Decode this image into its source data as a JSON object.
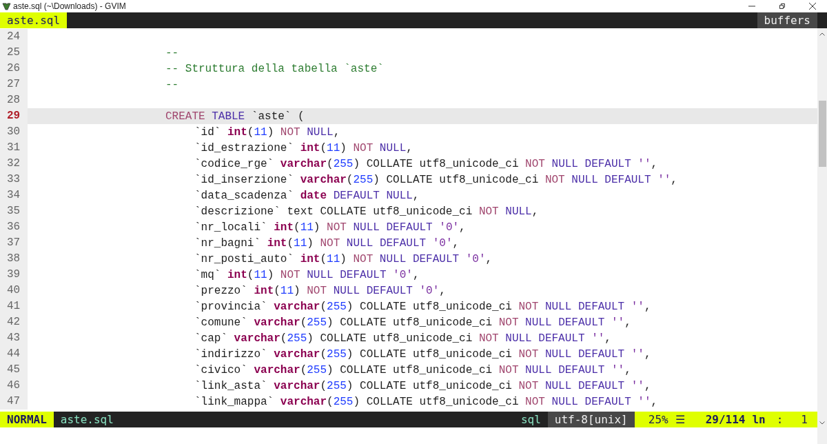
{
  "window": {
    "title": "aste.sql (~\\Downloads) - GVIM"
  },
  "tabline": {
    "tabs": [
      {
        "label": "aste.sql",
        "selected": true
      }
    ],
    "right_label": "buffers"
  },
  "lines": [
    {
      "number": "24",
      "kind": "blank",
      "current": false
    },
    {
      "number": "25",
      "kind": "comment",
      "current": false,
      "tokens": [
        {
          "kind": "comment",
          "text": "--"
        }
      ]
    },
    {
      "number": "26",
      "kind": "comment",
      "current": false,
      "tokens": [
        {
          "kind": "comment",
          "text": "-- Struttura della tabella `aste`"
        }
      ]
    },
    {
      "number": "27",
      "kind": "comment",
      "current": false,
      "tokens": [
        {
          "kind": "comment",
          "text": "--"
        }
      ]
    },
    {
      "number": "28",
      "kind": "blank",
      "current": false
    },
    {
      "number": "29",
      "kind": "statement",
      "current": true,
      "tokens": [
        {
          "kind": "keyword",
          "text": "CREATE"
        },
        {
          "kind": "constant",
          "text": " TABLE"
        },
        {
          "kind": "plain",
          "text": " `aste` ("
        }
      ]
    },
    {
      "number": "30",
      "kind": "column",
      "current": false,
      "tokens": [
        {
          "kind": "plain",
          "text": "`id` "
        },
        {
          "kind": "type",
          "text": "int"
        },
        {
          "kind": "plain",
          "text": "("
        },
        {
          "kind": "number",
          "text": "11"
        },
        {
          "kind": "plain",
          "text": ") "
        },
        {
          "kind": "keyword",
          "text": "NOT"
        },
        {
          "kind": "constant",
          "text": " NULL"
        },
        {
          "kind": "plain",
          "text": ","
        }
      ]
    },
    {
      "number": "31",
      "kind": "column",
      "current": false,
      "tokens": [
        {
          "kind": "plain",
          "text": "`id_estrazione` "
        },
        {
          "kind": "type",
          "text": "int"
        },
        {
          "kind": "plain",
          "text": "("
        },
        {
          "kind": "number",
          "text": "11"
        },
        {
          "kind": "plain",
          "text": ") "
        },
        {
          "kind": "keyword",
          "text": "NOT"
        },
        {
          "kind": "constant",
          "text": " NULL"
        },
        {
          "kind": "plain",
          "text": ","
        }
      ]
    },
    {
      "number": "32",
      "kind": "column",
      "current": false,
      "tokens": [
        {
          "kind": "plain",
          "text": "`codice_rge` "
        },
        {
          "kind": "type",
          "text": "varchar"
        },
        {
          "kind": "plain",
          "text": "("
        },
        {
          "kind": "number",
          "text": "255"
        },
        {
          "kind": "plain",
          "text": ") COLLATE utf8_unicode_ci "
        },
        {
          "kind": "keyword",
          "text": "NOT"
        },
        {
          "kind": "constant",
          "text": " NULL DEFAULT "
        },
        {
          "kind": "string",
          "text": "''"
        },
        {
          "kind": "plain",
          "text": ","
        }
      ]
    },
    {
      "number": "33",
      "kind": "column",
      "current": false,
      "tokens": [
        {
          "kind": "plain",
          "text": "`id_inserzione` "
        },
        {
          "kind": "type",
          "text": "varchar"
        },
        {
          "kind": "plain",
          "text": "("
        },
        {
          "kind": "number",
          "text": "255"
        },
        {
          "kind": "plain",
          "text": ") COLLATE utf8_unicode_ci "
        },
        {
          "kind": "keyword",
          "text": "NOT"
        },
        {
          "kind": "constant",
          "text": " NULL DEFAULT "
        },
        {
          "kind": "string",
          "text": "''"
        },
        {
          "kind": "plain",
          "text": ","
        }
      ]
    },
    {
      "number": "34",
      "kind": "column",
      "current": false,
      "tokens": [
        {
          "kind": "plain",
          "text": "`data_scadenza` "
        },
        {
          "kind": "type",
          "text": "date"
        },
        {
          "kind": "constant",
          "text": " DEFAULT NULL"
        },
        {
          "kind": "plain",
          "text": ","
        }
      ]
    },
    {
      "number": "35",
      "kind": "column",
      "current": false,
      "tokens": [
        {
          "kind": "plain",
          "text": "`descrizione` text COLLATE utf8_unicode_ci "
        },
        {
          "kind": "keyword",
          "text": "NOT"
        },
        {
          "kind": "constant",
          "text": " NULL"
        },
        {
          "kind": "plain",
          "text": ","
        }
      ]
    },
    {
      "number": "36",
      "kind": "column",
      "current": false,
      "tokens": [
        {
          "kind": "plain",
          "text": "`nr_locali` "
        },
        {
          "kind": "type",
          "text": "int"
        },
        {
          "kind": "plain",
          "text": "("
        },
        {
          "kind": "number",
          "text": "11"
        },
        {
          "kind": "plain",
          "text": ") "
        },
        {
          "kind": "keyword",
          "text": "NOT"
        },
        {
          "kind": "constant",
          "text": " NULL DEFAULT "
        },
        {
          "kind": "string",
          "text": "'0'"
        },
        {
          "kind": "plain",
          "text": ","
        }
      ]
    },
    {
      "number": "37",
      "kind": "column",
      "current": false,
      "tokens": [
        {
          "kind": "plain",
          "text": "`nr_bagni` "
        },
        {
          "kind": "type",
          "text": "int"
        },
        {
          "kind": "plain",
          "text": "("
        },
        {
          "kind": "number",
          "text": "11"
        },
        {
          "kind": "plain",
          "text": ") "
        },
        {
          "kind": "keyword",
          "text": "NOT"
        },
        {
          "kind": "constant",
          "text": " NULL DEFAULT "
        },
        {
          "kind": "string",
          "text": "'0'"
        },
        {
          "kind": "plain",
          "text": ","
        }
      ]
    },
    {
      "number": "38",
      "kind": "column",
      "current": false,
      "tokens": [
        {
          "kind": "plain",
          "text": "`nr_posti_auto` "
        },
        {
          "kind": "type",
          "text": "int"
        },
        {
          "kind": "plain",
          "text": "("
        },
        {
          "kind": "number",
          "text": "11"
        },
        {
          "kind": "plain",
          "text": ") "
        },
        {
          "kind": "keyword",
          "text": "NOT"
        },
        {
          "kind": "constant",
          "text": " NULL DEFAULT "
        },
        {
          "kind": "string",
          "text": "'0'"
        },
        {
          "kind": "plain",
          "text": ","
        }
      ]
    },
    {
      "number": "39",
      "kind": "column",
      "current": false,
      "tokens": [
        {
          "kind": "plain",
          "text": "`mq` "
        },
        {
          "kind": "type",
          "text": "int"
        },
        {
          "kind": "plain",
          "text": "("
        },
        {
          "kind": "number",
          "text": "11"
        },
        {
          "kind": "plain",
          "text": ") "
        },
        {
          "kind": "keyword",
          "text": "NOT"
        },
        {
          "kind": "constant",
          "text": " NULL DEFAULT "
        },
        {
          "kind": "string",
          "text": "'0'"
        },
        {
          "kind": "plain",
          "text": ","
        }
      ]
    },
    {
      "number": "40",
      "kind": "column",
      "current": false,
      "tokens": [
        {
          "kind": "plain",
          "text": "`prezzo` "
        },
        {
          "kind": "type",
          "text": "int"
        },
        {
          "kind": "plain",
          "text": "("
        },
        {
          "kind": "number",
          "text": "11"
        },
        {
          "kind": "plain",
          "text": ") "
        },
        {
          "kind": "keyword",
          "text": "NOT"
        },
        {
          "kind": "constant",
          "text": " NULL DEFAULT "
        },
        {
          "kind": "string",
          "text": "'0'"
        },
        {
          "kind": "plain",
          "text": ","
        }
      ]
    },
    {
      "number": "41",
      "kind": "column",
      "current": false,
      "tokens": [
        {
          "kind": "plain",
          "text": "`provincia` "
        },
        {
          "kind": "type",
          "text": "varchar"
        },
        {
          "kind": "plain",
          "text": "("
        },
        {
          "kind": "number",
          "text": "255"
        },
        {
          "kind": "plain",
          "text": ") COLLATE utf8_unicode_ci "
        },
        {
          "kind": "keyword",
          "text": "NOT"
        },
        {
          "kind": "constant",
          "text": " NULL DEFAULT "
        },
        {
          "kind": "string",
          "text": "''"
        },
        {
          "kind": "plain",
          "text": ","
        }
      ]
    },
    {
      "number": "42",
      "kind": "column",
      "current": false,
      "tokens": [
        {
          "kind": "plain",
          "text": "`comune` "
        },
        {
          "kind": "type",
          "text": "varchar"
        },
        {
          "kind": "plain",
          "text": "("
        },
        {
          "kind": "number",
          "text": "255"
        },
        {
          "kind": "plain",
          "text": ") COLLATE utf8_unicode_ci "
        },
        {
          "kind": "keyword",
          "text": "NOT"
        },
        {
          "kind": "constant",
          "text": " NULL DEFAULT "
        },
        {
          "kind": "string",
          "text": "''"
        },
        {
          "kind": "plain",
          "text": ","
        }
      ]
    },
    {
      "number": "43",
      "kind": "column",
      "current": false,
      "tokens": [
        {
          "kind": "plain",
          "text": "`cap` "
        },
        {
          "kind": "type",
          "text": "varchar"
        },
        {
          "kind": "plain",
          "text": "("
        },
        {
          "kind": "number",
          "text": "255"
        },
        {
          "kind": "plain",
          "text": ") COLLATE utf8_unicode_ci "
        },
        {
          "kind": "keyword",
          "text": "NOT"
        },
        {
          "kind": "constant",
          "text": " NULL DEFAULT "
        },
        {
          "kind": "string",
          "text": "''"
        },
        {
          "kind": "plain",
          "text": ","
        }
      ]
    },
    {
      "number": "44",
      "kind": "column",
      "current": false,
      "tokens": [
        {
          "kind": "plain",
          "text": "`indirizzo` "
        },
        {
          "kind": "type",
          "text": "varchar"
        },
        {
          "kind": "plain",
          "text": "("
        },
        {
          "kind": "number",
          "text": "255"
        },
        {
          "kind": "plain",
          "text": ") COLLATE utf8_unicode_ci "
        },
        {
          "kind": "keyword",
          "text": "NOT"
        },
        {
          "kind": "constant",
          "text": " NULL DEFAULT "
        },
        {
          "kind": "string",
          "text": "''"
        },
        {
          "kind": "plain",
          "text": ","
        }
      ]
    },
    {
      "number": "45",
      "kind": "column",
      "current": false,
      "tokens": [
        {
          "kind": "plain",
          "text": "`civico` "
        },
        {
          "kind": "type",
          "text": "varchar"
        },
        {
          "kind": "plain",
          "text": "("
        },
        {
          "kind": "number",
          "text": "255"
        },
        {
          "kind": "plain",
          "text": ") COLLATE utf8_unicode_ci "
        },
        {
          "kind": "keyword",
          "text": "NOT"
        },
        {
          "kind": "constant",
          "text": " NULL DEFAULT "
        },
        {
          "kind": "string",
          "text": "''"
        },
        {
          "kind": "plain",
          "text": ","
        }
      ]
    },
    {
      "number": "46",
      "kind": "column",
      "current": false,
      "tokens": [
        {
          "kind": "plain",
          "text": "`link_asta` "
        },
        {
          "kind": "type",
          "text": "varchar"
        },
        {
          "kind": "plain",
          "text": "("
        },
        {
          "kind": "number",
          "text": "255"
        },
        {
          "kind": "plain",
          "text": ") COLLATE utf8_unicode_ci "
        },
        {
          "kind": "keyword",
          "text": "NOT"
        },
        {
          "kind": "constant",
          "text": " NULL DEFAULT "
        },
        {
          "kind": "string",
          "text": "''"
        },
        {
          "kind": "plain",
          "text": ","
        }
      ]
    },
    {
      "number": "47",
      "kind": "column",
      "current": false,
      "tokens": [
        {
          "kind": "plain",
          "text": "`link_mappa` "
        },
        {
          "kind": "type",
          "text": "varchar"
        },
        {
          "kind": "plain",
          "text": "("
        },
        {
          "kind": "number",
          "text": "255"
        },
        {
          "kind": "plain",
          "text": ") COLLATE utf8_unicode_ci "
        },
        {
          "kind": "keyword",
          "text": "NOT"
        },
        {
          "kind": "constant",
          "text": " NULL DEFAULT "
        },
        {
          "kind": "string",
          "text": "''"
        },
        {
          "kind": "plain",
          "text": ","
        }
      ]
    }
  ],
  "status_bar": {
    "mode": "NORMAL",
    "file": "aste.sql",
    "filetype": "sql",
    "encoding": "utf-8[unix]",
    "percent": "25%",
    "percent_symbol": "☰",
    "position": "29/114",
    "line_label": "ln",
    "separator": ":",
    "column": "1"
  }
}
